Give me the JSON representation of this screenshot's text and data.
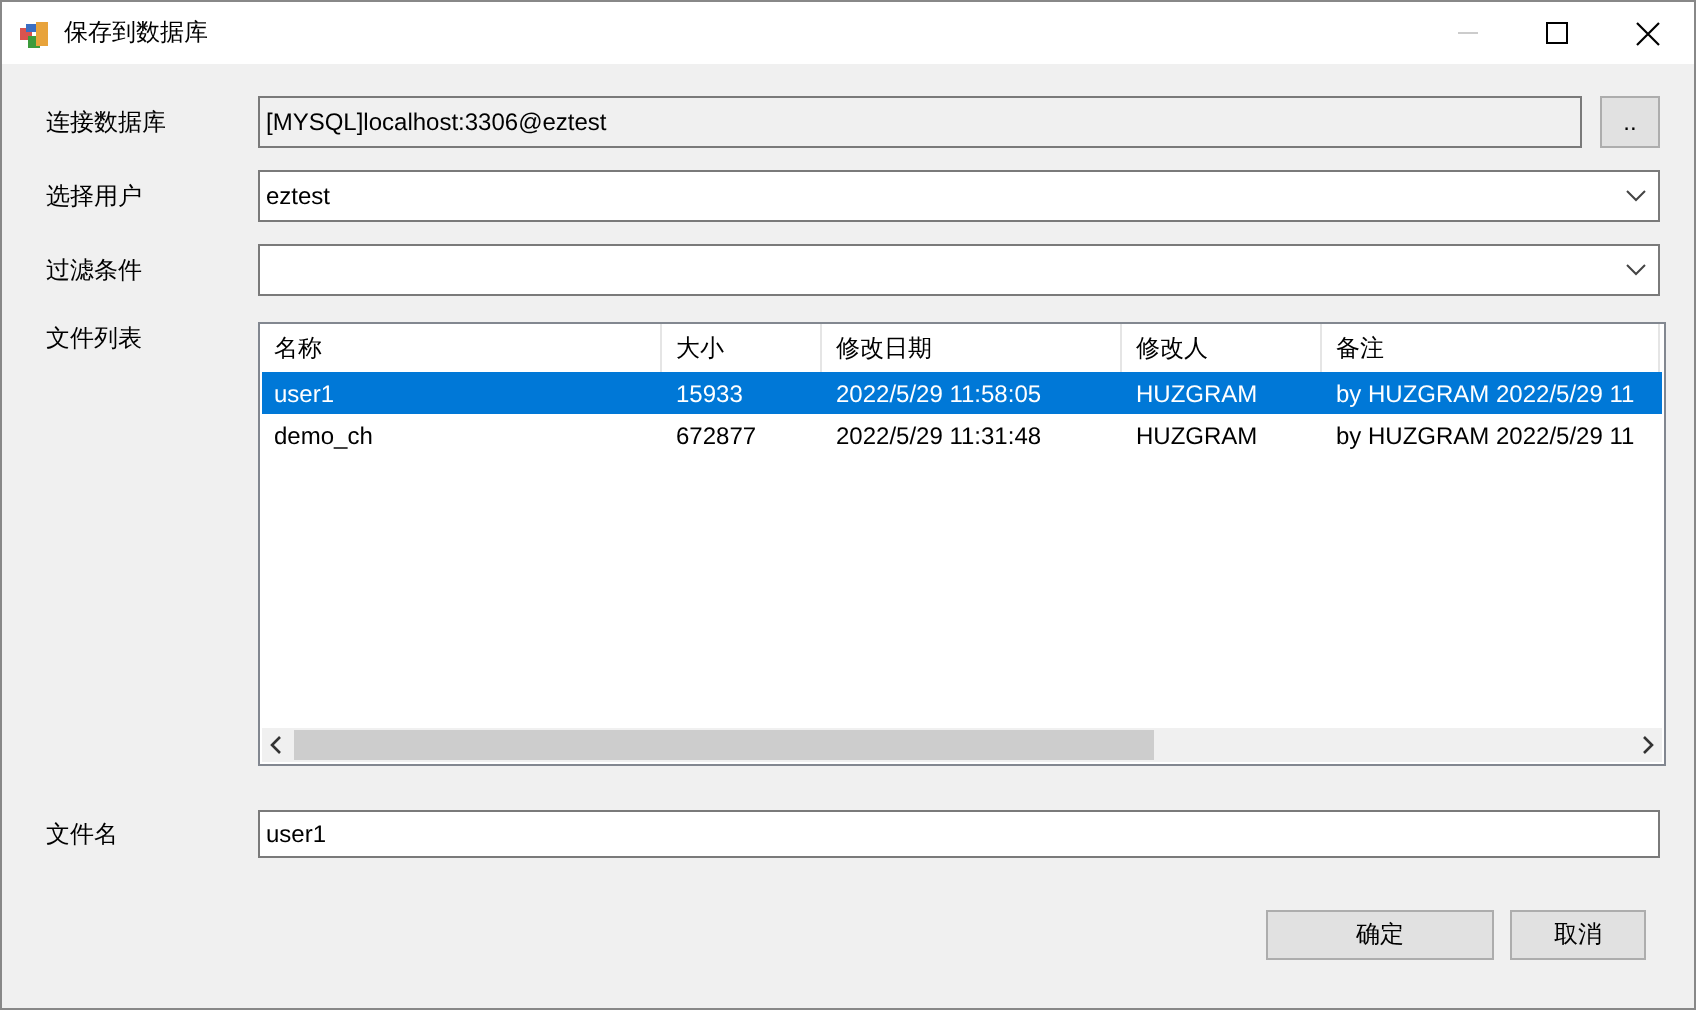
{
  "window": {
    "title": "保存到数据库"
  },
  "form": [
    {
      "kind": "readonly",
      "label": "连接数据库",
      "value": "[MYSQL]localhost:3306@eztest",
      "button": ".."
    },
    {
      "kind": "dropdown",
      "label": "选择用户",
      "value": "eztest"
    },
    {
      "kind": "dropdown",
      "label": "过滤条件"
    }
  ],
  "file_list": {
    "label": "文件列表",
    "columns": [
      "名称",
      "大小",
      "修改日期",
      "修改人",
      "备注"
    ],
    "rows": [
      {
        "cells": [
          "user1",
          "15933",
          "2022/5/29 11:58:05",
          "HUZGRAM",
          "by HUZGRAM 2022/5/29 11"
        ],
        "selected": true
      },
      {
        "cells": [
          "demo_ch",
          "672877",
          "2022/5/29 11:31:48",
          "HUZGRAM",
          "by HUZGRAM 2022/5/29 11"
        ],
        "selected": false
      }
    ]
  },
  "filename": {
    "label": "文件名",
    "value": "user1"
  },
  "buttons": [
    "确定",
    "取消"
  ]
}
